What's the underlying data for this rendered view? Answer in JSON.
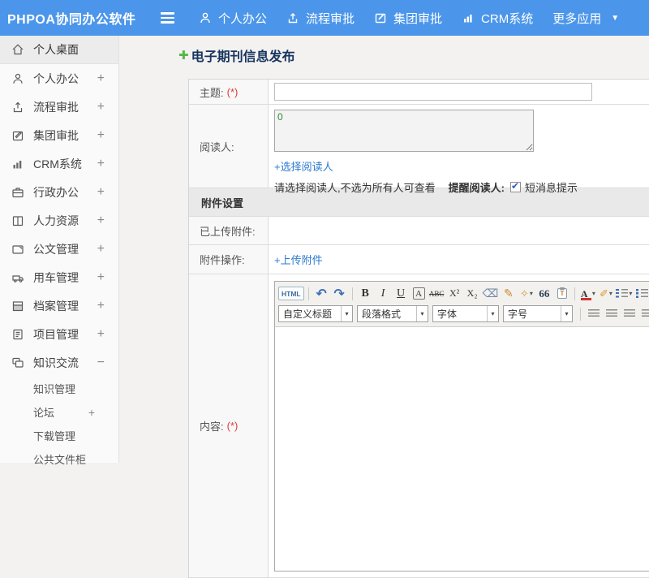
{
  "header": {
    "logo": "PHPOA协同办公软件",
    "nav": [
      {
        "label": "个人办公",
        "icon": "user-icon"
      },
      {
        "label": "流程审批",
        "icon": "share-icon"
      },
      {
        "label": "集团审批",
        "icon": "edit-icon"
      },
      {
        "label": "CRM系统",
        "icon": "chart-icon"
      },
      {
        "label": "更多应用",
        "icon": "caret-down-icon"
      }
    ]
  },
  "sidebar": {
    "items": [
      {
        "label": "个人桌面",
        "icon": "home-icon",
        "active": true
      },
      {
        "label": "个人办公",
        "icon": "user-icon",
        "expand": "+"
      },
      {
        "label": "流程审批",
        "icon": "share-icon",
        "expand": "+"
      },
      {
        "label": "集团审批",
        "icon": "edit-icon",
        "expand": "+"
      },
      {
        "label": "CRM系统",
        "icon": "chart-icon",
        "expand": "+"
      },
      {
        "label": "行政办公",
        "icon": "briefcase-icon",
        "expand": "+"
      },
      {
        "label": "人力资源",
        "icon": "book-icon",
        "expand": "+"
      },
      {
        "label": "公文管理",
        "icon": "folder-icon",
        "expand": "+"
      },
      {
        "label": "用车管理",
        "icon": "car-icon",
        "expand": "+"
      },
      {
        "label": "档案管理",
        "icon": "archive-icon",
        "expand": "+"
      },
      {
        "label": "项目管理",
        "icon": "clipboard-icon",
        "expand": "+"
      },
      {
        "label": "知识交流",
        "icon": "layers-icon",
        "expand": "−",
        "expanded": true
      }
    ],
    "subitems": [
      {
        "label": "知识管理"
      },
      {
        "label": "论坛",
        "expand": "+"
      },
      {
        "label": "下载管理"
      },
      {
        "label": "公共文件柜"
      }
    ]
  },
  "main": {
    "page_title": "电子期刊信息发布",
    "form": {
      "subject_label": "主题:",
      "required_mark": "(*)",
      "readers_label": "阅读人:",
      "readers_count": "0",
      "select_readers_link": "+选择阅读人",
      "readers_hint": "请选择阅读人,不选为所有人可查看",
      "remind_label": "提醒阅读人:",
      "sms_option": "短消息提示",
      "sms_checked": true,
      "attachment_section_title": "附件设置",
      "uploaded_label": "已上传附件:",
      "operation_label": "附件操作:",
      "upload_link": "+上传附件",
      "content_label": "内容:"
    },
    "editor": {
      "source_btn": "HTML",
      "bold": "B",
      "italic": "I",
      "underline": "U",
      "font_style": "A",
      "strike": "ABC",
      "superscript": "X²",
      "subscript": "X₂",
      "quote": "66",
      "paste_text": "T",
      "forecolor": "A",
      "selects": [
        "自定义标题",
        "段落格式",
        "字体",
        "字号"
      ]
    }
  },
  "icons": {
    "plus": "✚",
    "undo": "↶",
    "redo": "↷",
    "caret": "▾",
    "nav_caret": "▼",
    "check": "✔",
    "chain": "∞",
    "brush": "✎",
    "highlight_pen": "✐",
    "wand": "✧",
    "eraser": "⌫",
    "unlink_x": "×"
  },
  "colors": {
    "header_blue": "#4b96ea",
    "link_blue": "#2b7ad0",
    "title_navy": "#17345f",
    "plus_green": "#53b947",
    "required_red": "#e03a3a",
    "count_green": "#2f8a2f"
  }
}
